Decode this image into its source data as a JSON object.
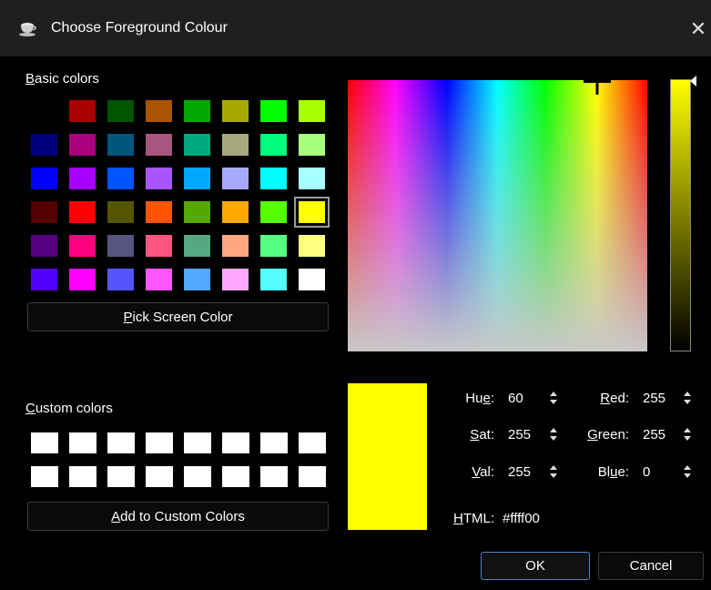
{
  "window": {
    "title": "Choose Foreground Colour",
    "icon": "teacup-icon",
    "close_icon": "close-icon",
    "close_glyph": "✕"
  },
  "basic": {
    "heading_underlined": "B",
    "heading_rest": "asic colors",
    "selected_index": 31,
    "colors": [
      "#000000",
      "#a80000",
      "#005500",
      "#a85400",
      "#00a800",
      "#a8a800",
      "#00ff00",
      "#a8ff00",
      "#00007f",
      "#a8007f",
      "#00557f",
      "#a8557f",
      "#00a87f",
      "#a8a87f",
      "#00ff7f",
      "#a8ff7f",
      "#0000ff",
      "#a800ff",
      "#0055ff",
      "#a855ff",
      "#00a8ff",
      "#a8a8ff",
      "#00ffff",
      "#a8ffff",
      "#550000",
      "#ff0000",
      "#555500",
      "#ff5500",
      "#55a800",
      "#ffa800",
      "#55ff00",
      "#ffff00",
      "#55007f",
      "#ff007f",
      "#55557f",
      "#ff557f",
      "#55a87f",
      "#ffa87f",
      "#55ff7f",
      "#ffff7f",
      "#5500ff",
      "#ff00ff",
      "#5555ff",
      "#ff55ff",
      "#55a8ff",
      "#ffa8ff",
      "#55ffff",
      "#ffffff"
    ]
  },
  "pick_screen": {
    "underlined": "P",
    "rest": "ick Screen Color"
  },
  "custom": {
    "heading_underlined": "C",
    "heading_rest": "ustom colors",
    "colors": [
      "#ffffff",
      "#ffffff",
      "#ffffff",
      "#ffffff",
      "#ffffff",
      "#ffffff",
      "#ffffff",
      "#ffffff",
      "#ffffff",
      "#ffffff",
      "#ffffff",
      "#ffffff",
      "#ffffff",
      "#ffffff",
      "#ffffff",
      "#ffffff"
    ]
  },
  "add_custom": {
    "underlined": "A",
    "rest": "dd to Custom Colors"
  },
  "fields": {
    "hue": {
      "pre": "Hu",
      "u": "e",
      "post": ":",
      "value": "60"
    },
    "sat": {
      "pre": "",
      "u": "S",
      "post": "at:",
      "value": "255"
    },
    "val": {
      "pre": "",
      "u": "V",
      "post": "al:",
      "value": "255"
    },
    "red": {
      "pre": "",
      "u": "R",
      "post": "ed:",
      "value": "255"
    },
    "green": {
      "pre": "",
      "u": "G",
      "post": "reen:",
      "value": "255"
    },
    "blue": {
      "pre": "Bl",
      "u": "u",
      "post": "e:",
      "value": "0"
    },
    "html": {
      "pre": "",
      "u": "H",
      "post": "TML:",
      "value": "#ffff00"
    }
  },
  "current_color": "#ffff00",
  "buttons": {
    "ok": "OK",
    "cancel": "Cancel"
  }
}
